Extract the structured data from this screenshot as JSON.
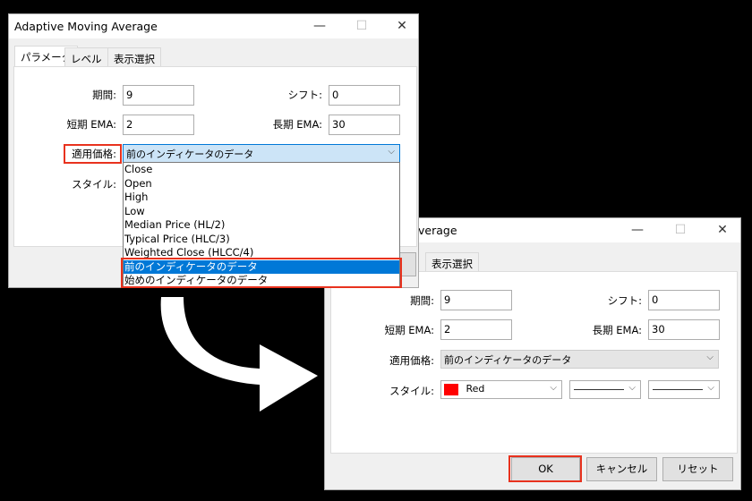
{
  "window_back": {
    "title_fragment": "verage",
    "tab": "表示選択",
    "period_label": "期間:",
    "period_value": "9",
    "shift_label": "シフト:",
    "shift_value": "0",
    "short_ema_label": "短期 EMA:",
    "short_ema_value": "2",
    "long_ema_label": "長期 EMA:",
    "long_ema_value": "30",
    "applied_price_label": "適用価格:",
    "applied_price_value": "前のインディケータのデータ",
    "style_label": "スタイル:",
    "style_color": "Red",
    "style_color_hex": "#ff0000",
    "ok": "OK",
    "cancel": "キャンセル",
    "reset": "リセット"
  },
  "window_front": {
    "title": "Adaptive Moving Average",
    "tabs": [
      "パラメータ",
      "レベル",
      "表示選択"
    ],
    "period_label": "期間:",
    "period_value": "9",
    "shift_label": "シフト:",
    "shift_value": "0",
    "short_ema_label": "短期 EMA:",
    "short_ema_value": "2",
    "long_ema_label": "長期 EMA:",
    "long_ema_value": "30",
    "applied_price_label": "適用価格:",
    "applied_price_value": "前のインディケータのデータ",
    "style_label": "スタイル:",
    "dropdown_options": [
      "Close",
      "Open",
      "High",
      "Low",
      "Median Price (HL/2)",
      "Typical Price (HLC/3)",
      "Weighted Close (HLCC/4)",
      "前のインディケータのデータ",
      "始めのインディケータのデータ"
    ],
    "selected_option": "前のインディケータのデータ"
  },
  "colors": {
    "highlight": "#e8321e",
    "selection": "#0078d7",
    "background": "#000000"
  }
}
